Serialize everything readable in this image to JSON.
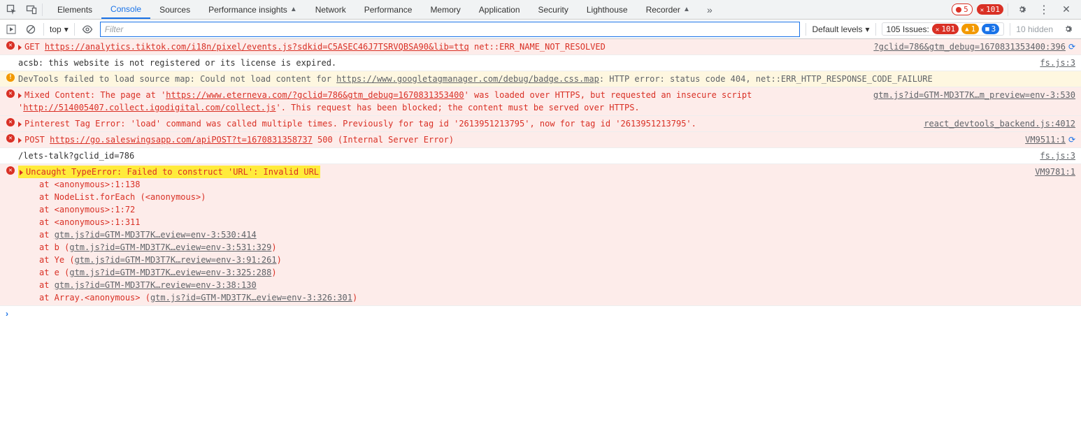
{
  "topbar": {
    "tabs": [
      {
        "label": "Elements"
      },
      {
        "label": "Console",
        "active": true
      },
      {
        "label": "Sources"
      },
      {
        "label": "Performance insights",
        "indicator": "▲"
      },
      {
        "label": "Network"
      },
      {
        "label": "Performance"
      },
      {
        "label": "Memory"
      },
      {
        "label": "Application"
      },
      {
        "label": "Security"
      },
      {
        "label": "Lighthouse"
      },
      {
        "label": "Recorder",
        "indicator": "▲"
      }
    ],
    "errors_outline": "5",
    "errors_fill": "101"
  },
  "toolbar": {
    "context": "top",
    "filter_placeholder": "Filter",
    "default_levels": "Default levels",
    "issues_label": "105 Issues:",
    "issues_err": "101",
    "issues_warn": "1",
    "issues_info": "3",
    "hidden": "10 hidden"
  },
  "rows": [
    {
      "type": "error",
      "expand": true,
      "parts": [
        {
          "t": "GET ",
          "cls": ""
        },
        {
          "t": "https://analytics.tiktok.com/i18n/pixel/events.js?sdkid=C5ASEC46J7TSRVQBSA90&lib=ttq",
          "cls": "link u"
        },
        {
          "t": " net::ERR_NAME_NOT_RESOLVED",
          "cls": ""
        }
      ],
      "src": "?gclid=786&gtm_debug=1670831353400:396",
      "goto": true
    },
    {
      "type": "log",
      "parts": [
        {
          "t": "acsb: this website is not registered or its license is expired.",
          "cls": ""
        }
      ],
      "src": "fs.js:3"
    },
    {
      "type": "warn",
      "parts": [
        {
          "t": "DevTools failed to load source map: Could not load content for ",
          "cls": ""
        },
        {
          "t": "https://www.googletagmanager.com/debug/badge.css.map",
          "cls": "link u"
        },
        {
          "t": ": HTTP error: status code 404, net::ERR_HTTP_RESPONSE_CODE_FAILURE",
          "cls": ""
        }
      ]
    },
    {
      "type": "error",
      "expand": true,
      "parts": [
        {
          "t": "Mixed Content: The page at '",
          "cls": ""
        },
        {
          "t": "https://www.eterneva.com/?gclid=786&gtm_debug=1670831353400",
          "cls": "link u"
        },
        {
          "t": "' was loaded over HTTPS, but requested an insecure script '",
          "cls": ""
        },
        {
          "t": "http://514005407.collect.igodigital.com/collect.js",
          "cls": "link u"
        },
        {
          "t": "'. This request has been blocked; the content must be served over HTTPS.",
          "cls": ""
        }
      ],
      "src": "gtm.js?id=GTM-MD3T7K…m_preview=env-3:530"
    },
    {
      "type": "error",
      "expand": true,
      "parts": [
        {
          "t": "Pinterest Tag Error: 'load' command was called multiple times.  Previously for tag id '2613951213795', now for tag id '2613951213795'.",
          "cls": ""
        }
      ],
      "src": "react_devtools_backend.js:4012"
    },
    {
      "type": "error",
      "expand": true,
      "parts": [
        {
          "t": "POST ",
          "cls": ""
        },
        {
          "t": "https://go.saleswingsapp.com/apiPOST?t=1670831358737",
          "cls": "link u"
        },
        {
          "t": " 500 (Internal Server Error)",
          "cls": ""
        }
      ],
      "src": "VM9511:1",
      "goto": true
    },
    {
      "type": "log",
      "parts": [
        {
          "t": "/lets-talk?gclid_id=786",
          "cls": ""
        }
      ],
      "src": "fs.js:3"
    }
  ],
  "highlight_row": {
    "msg": "Uncaught TypeError: Failed to construct 'URL': Invalid URL",
    "src": "VM9781:1",
    "stack": [
      {
        "pre": "    at <anonymous>:1:138"
      },
      {
        "pre": "    at NodeList.forEach (<anonymous>)"
      },
      {
        "pre": "    at <anonymous>:1:72"
      },
      {
        "pre": "    at <anonymous>:1:311"
      },
      {
        "pre": "    at ",
        "loc": "gtm.js?id=GTM-MD3T7K…eview=env-3:530:414"
      },
      {
        "pre": "    at b (",
        "loc": "gtm.js?id=GTM-MD3T7K…eview=env-3:531:329",
        "post": ")"
      },
      {
        "pre": "    at Ye (",
        "loc": "gtm.js?id=GTM-MD3T7K…review=env-3:91:261",
        "post": ")"
      },
      {
        "pre": "    at e (",
        "loc": "gtm.js?id=GTM-MD3T7K…eview=env-3:325:288",
        "post": ")"
      },
      {
        "pre": "    at ",
        "loc": "gtm.js?id=GTM-MD3T7K…review=env-3:38:130"
      },
      {
        "pre": "    at Array.<anonymous> (",
        "loc": "gtm.js?id=GTM-MD3T7K…eview=env-3:326:301",
        "post": ")"
      }
    ]
  }
}
